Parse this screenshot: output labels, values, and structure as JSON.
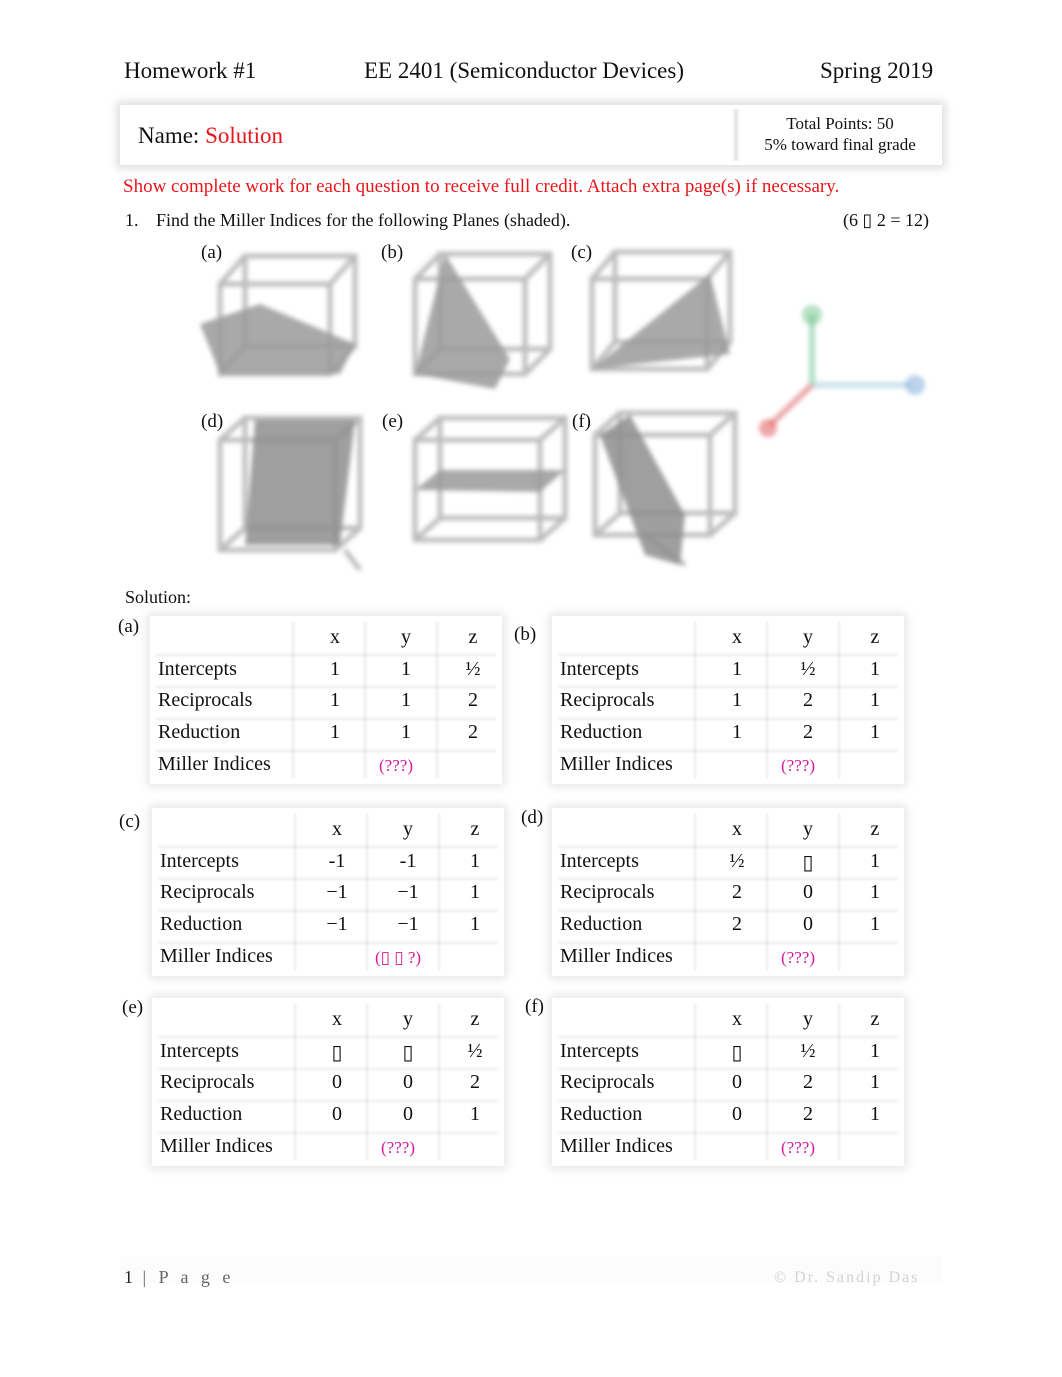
{
  "header": {
    "left": "Homework #1",
    "center": "EE 2401 (Semiconductor Devices)",
    "right": "Spring 2019"
  },
  "name_box": {
    "label": "Name:",
    "value": "Solution",
    "total_points": "Total Points: 50",
    "weight": "5% toward final grade"
  },
  "colors": {
    "instruction_red": "#e8161b",
    "miller_magenta": "#d6179b",
    "axis_x_red": "#e05050",
    "axis_y_blue": "#7aa8d8",
    "axis_z_green": "#6cc28a"
  },
  "instructions": "Show complete work for each question to receive full credit. Attach extra page(s) if necessary.",
  "question1": {
    "number": "1.",
    "text": "Find the Miller Indices for the following Planes (shaded).",
    "points": "(6 ▯ 2 = 12)"
  },
  "figures": [
    {
      "label": "(a)"
    },
    {
      "label": "(b)"
    },
    {
      "label": "(c)"
    },
    {
      "label": "(d)"
    },
    {
      "label": "(e)"
    },
    {
      "label": "(f)"
    }
  ],
  "solution_label": "Solution:",
  "tables": [
    {
      "label": "(a)",
      "headers": [
        "x",
        "y",
        "z"
      ],
      "rows": [
        {
          "name": "Intercepts",
          "values": [
            "1",
            "1",
            "½"
          ]
        },
        {
          "name": "Reciprocals",
          "values": [
            "1",
            "1",
            "2"
          ]
        },
        {
          "name": "Reduction",
          "values": [
            "1",
            "1",
            "2"
          ]
        }
      ],
      "miller_label": "Miller Indices",
      "miller_value": "(???)"
    },
    {
      "label": "(b)",
      "headers": [
        "x",
        "y",
        "z"
      ],
      "rows": [
        {
          "name": "Intercepts",
          "values": [
            "1",
            "½",
            "1"
          ]
        },
        {
          "name": "Reciprocals",
          "values": [
            "1",
            "2",
            "1"
          ]
        },
        {
          "name": "Reduction",
          "values": [
            "1",
            "2",
            "1"
          ]
        }
      ],
      "miller_label": "Miller Indices",
      "miller_value": "(???)"
    },
    {
      "label": "(c)",
      "headers": [
        "x",
        "y",
        "z"
      ],
      "rows": [
        {
          "name": "Intercepts",
          "values": [
            "-1",
            "-1",
            "1"
          ]
        },
        {
          "name": "Reciprocals",
          "values": [
            "−1",
            "−1",
            "1"
          ]
        },
        {
          "name": "Reduction",
          "values": [
            "−1",
            "−1",
            "1"
          ]
        }
      ],
      "miller_label": "Miller Indices",
      "miller_value": "(▯ ▯ ?)"
    },
    {
      "label": "(d)",
      "headers": [
        "x",
        "y",
        "z"
      ],
      "rows": [
        {
          "name": "Intercepts",
          "values": [
            "½",
            "▯",
            "1"
          ]
        },
        {
          "name": "Reciprocals",
          "values": [
            "2",
            "0",
            "1"
          ]
        },
        {
          "name": "Reduction",
          "values": [
            "2",
            "0",
            "1"
          ]
        }
      ],
      "miller_label": "Miller Indices",
      "miller_value": "(???)"
    },
    {
      "label": "(e)",
      "headers": [
        "x",
        "y",
        "z"
      ],
      "rows": [
        {
          "name": "Intercepts",
          "values": [
            "▯",
            "▯",
            "½"
          ]
        },
        {
          "name": "Reciprocals",
          "values": [
            "0",
            "0",
            "2"
          ]
        },
        {
          "name": "Reduction",
          "values": [
            "0",
            "0",
            "1"
          ]
        }
      ],
      "miller_label": "Miller Indices",
      "miller_value": "(???)"
    },
    {
      "label": "(f)",
      "headers": [
        "x",
        "y",
        "z"
      ],
      "rows": [
        {
          "name": "Intercepts",
          "values": [
            "▯",
            "½",
            "1"
          ]
        },
        {
          "name": "Reciprocals",
          "values": [
            "0",
            "2",
            "1"
          ]
        },
        {
          "name": "Reduction",
          "values": [
            "0",
            "2",
            "1"
          ]
        }
      ],
      "miller_label": "Miller Indices",
      "miller_value": "(???)"
    }
  ],
  "footer": {
    "page_number": "1",
    "page_word": "| P a g e",
    "copyright": "© Dr. Sandip Das"
  }
}
